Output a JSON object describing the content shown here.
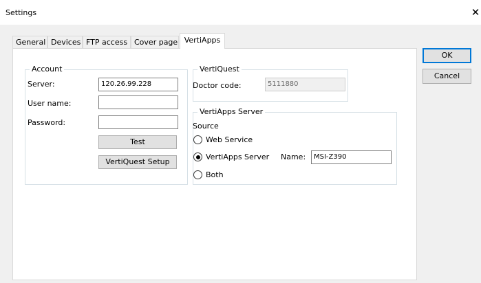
{
  "window": {
    "title": "Settings",
    "close_glyph": "✕"
  },
  "tabs": [
    {
      "label": "General",
      "active": false
    },
    {
      "label": "Devices",
      "active": false
    },
    {
      "label": "FTP access",
      "active": false
    },
    {
      "label": "Cover page",
      "active": false
    },
    {
      "label": "VertiApps",
      "active": true
    }
  ],
  "account": {
    "title": "Account",
    "server_label": "Server:",
    "server_value": "120.26.99.228",
    "username_label": "User name:",
    "username_value": "",
    "password_label": "Password:",
    "password_value": "",
    "test_button": "Test",
    "setup_button": "VertiQuest Setup"
  },
  "vertiquest": {
    "title": "VertiQuest",
    "doctor_code_label": "Doctor code:",
    "doctor_code_value": "5111880"
  },
  "vertiapps_server": {
    "title": "VertiApps Server",
    "source_label": "Source",
    "options": [
      {
        "label": "Web Service",
        "selected": false
      },
      {
        "label": "VertiApps Server",
        "selected": true
      },
      {
        "label": "Both",
        "selected": false
      }
    ],
    "name_label": "Name:",
    "name_value": "MSI-Z390"
  },
  "dialog_buttons": {
    "ok": "OK",
    "cancel": "Cancel"
  },
  "icons": {
    "close": "close-icon",
    "radio": "radio-button"
  }
}
